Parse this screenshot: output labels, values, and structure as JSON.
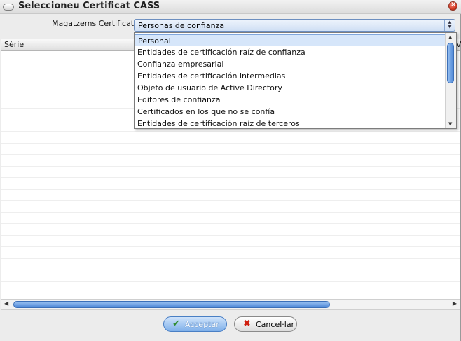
{
  "window": {
    "title": "Seleccioneu Certificat CASS"
  },
  "store": {
    "label": "Magatzems Certificats :",
    "selected": "Personas de confianza",
    "options": [
      "Personal",
      "Entidades de certificación raíz de confianza",
      "Confianza empresarial",
      "Entidades de certificación intermedias",
      "Objeto de usuario de Active Directory",
      "Editores de confianza",
      "Certificados en los que no se confía",
      "Entidades de certificación raíz de terceros"
    ]
  },
  "table": {
    "columns": [
      "Sèrie",
      "Vá"
    ]
  },
  "buttons": {
    "accept": "Acceptar",
    "cancel": "Cancel·lar"
  },
  "colors": {
    "accent": "#4c86d6",
    "close": "#d8402a"
  }
}
